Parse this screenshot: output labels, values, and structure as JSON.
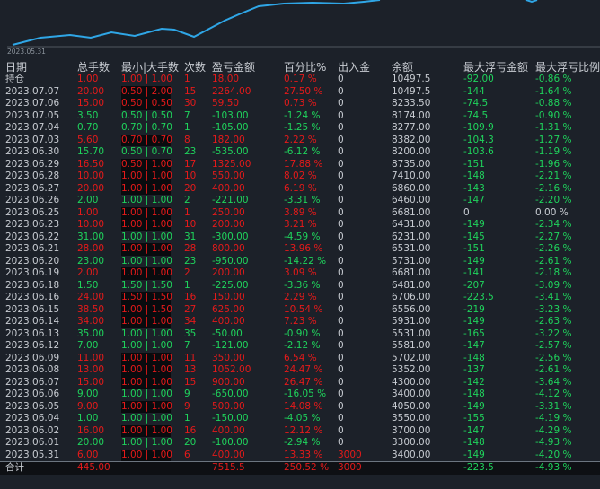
{
  "chart": {
    "date_label": "2023.05.31",
    "line_color": "#2fa6e6"
  },
  "headers": [
    "日期",
    "总手数",
    "最小|大手数",
    "次数",
    "盈亏金额",
    "百分比%",
    "出入金",
    "余额",
    "最大浮亏金额",
    "最大浮亏比例"
  ],
  "holding": {
    "label": "持仓",
    "lots": "1.00",
    "minmax": "1.00 | 1.00",
    "count": "1",
    "pnl": "18.00",
    "pct": "0.17 %",
    "flow": "0",
    "balance": "10497.5",
    "max_loss": "-92.00",
    "max_loss_pct": "-0.86 %"
  },
  "rows": [
    {
      "date": "2023.07.07",
      "lots": "20.00",
      "minmax": "0.50 | 2.00",
      "count": "15",
      "pnl": "2264.00",
      "pct": "27.50 %",
      "flow": "0",
      "balance": "10497.5",
      "max_loss": "-144",
      "max_loss_pct": "-1.64 %"
    },
    {
      "date": "2023.07.06",
      "lots": "15.00",
      "minmax": "0.50 | 0.50",
      "count": "30",
      "pnl": "59.50",
      "pct": "0.73 %",
      "flow": "0",
      "balance": "8233.50",
      "max_loss": "-74.5",
      "max_loss_pct": "-0.88 %"
    },
    {
      "date": "2023.07.05",
      "lots": "3.50",
      "minmax": "0.50 | 0.50",
      "count": "7",
      "pnl": "-103.00",
      "pct": "-1.24 %",
      "flow": "0",
      "balance": "8174.00",
      "max_loss": "-74.5",
      "max_loss_pct": "-0.90 %"
    },
    {
      "date": "2023.07.04",
      "lots": "0.70",
      "minmax": "0.70 | 0.70",
      "count": "1",
      "pnl": "-105.00",
      "pct": "-1.25 %",
      "flow": "0",
      "balance": "8277.00",
      "max_loss": "-109.9",
      "max_loss_pct": "-1.31 %"
    },
    {
      "date": "2023.07.03",
      "lots": "5.60",
      "minmax": "0.70 | 0.70",
      "count": "8",
      "pnl": "182.00",
      "pct": "2.22 %",
      "flow": "0",
      "balance": "8382.00",
      "max_loss": "-104.3",
      "max_loss_pct": "-1.27 %"
    },
    {
      "date": "2023.06.30",
      "lots": "15.70",
      "minmax": "0.50 | 0.70",
      "count": "23",
      "pnl": "-535.00",
      "pct": "-6.12 %",
      "flow": "0",
      "balance": "8200.00",
      "max_loss": "-103.6",
      "max_loss_pct": "-1.19 %"
    },
    {
      "date": "2023.06.29",
      "lots": "16.50",
      "minmax": "0.50 | 1.00",
      "count": "17",
      "pnl": "1325.00",
      "pct": "17.88 %",
      "flow": "0",
      "balance": "8735.00",
      "max_loss": "-151",
      "max_loss_pct": "-1.96 %"
    },
    {
      "date": "2023.06.28",
      "lots": "10.00",
      "minmax": "1.00 | 1.00",
      "count": "10",
      "pnl": "550.00",
      "pct": "8.02 %",
      "flow": "0",
      "balance": "7410.00",
      "max_loss": "-148",
      "max_loss_pct": "-2.21 %"
    },
    {
      "date": "2023.06.27",
      "lots": "20.00",
      "minmax": "1.00 | 1.00",
      "count": "20",
      "pnl": "400.00",
      "pct": "6.19 %",
      "flow": "0",
      "balance": "6860.00",
      "max_loss": "-143",
      "max_loss_pct": "-2.16 %"
    },
    {
      "date": "2023.06.26",
      "lots": "2.00",
      "minmax": "1.00 | 1.00",
      "count": "2",
      "pnl": "-221.00",
      "pct": "-3.31 %",
      "flow": "0",
      "balance": "6460.00",
      "max_loss": "-147",
      "max_loss_pct": "-2.20 %"
    },
    {
      "date": "2023.06.25",
      "lots": "1.00",
      "minmax": "1.00 | 1.00",
      "count": "1",
      "pnl": "250.00",
      "pct": "3.89 %",
      "flow": "0",
      "balance": "6681.00",
      "max_loss": "0",
      "max_loss_pct": "0.00 %"
    },
    {
      "date": "2023.06.23",
      "lots": "10.00",
      "minmax": "1.00 | 1.00",
      "count": "10",
      "pnl": "200.00",
      "pct": "3.21 %",
      "flow": "0",
      "balance": "6431.00",
      "max_loss": "-149",
      "max_loss_pct": "-2.34 %"
    },
    {
      "date": "2023.06.22",
      "lots": "31.00",
      "minmax": "1.00 | 1.00",
      "count": "31",
      "pnl": "-300.00",
      "pct": "-4.59 %",
      "flow": "0",
      "balance": "6231.00",
      "max_loss": "-145",
      "max_loss_pct": "-2.27 %"
    },
    {
      "date": "2023.06.21",
      "lots": "28.00",
      "minmax": "1.00 | 1.00",
      "count": "28",
      "pnl": "800.00",
      "pct": "13.96 %",
      "flow": "0",
      "balance": "6531.00",
      "max_loss": "-151",
      "max_loss_pct": "-2.26 %"
    },
    {
      "date": "2023.06.20",
      "lots": "23.00",
      "minmax": "1.00 | 1.00",
      "count": "23",
      "pnl": "-950.00",
      "pct": "-14.22 %",
      "flow": "0",
      "balance": "5731.00",
      "max_loss": "-149",
      "max_loss_pct": "-2.61 %"
    },
    {
      "date": "2023.06.19",
      "lots": "2.00",
      "minmax": "1.00 | 1.00",
      "count": "2",
      "pnl": "200.00",
      "pct": "3.09 %",
      "flow": "0",
      "balance": "6681.00",
      "max_loss": "-141",
      "max_loss_pct": "-2.18 %"
    },
    {
      "date": "2023.06.18",
      "lots": "1.50",
      "minmax": "1.50 | 1.50",
      "count": "1",
      "pnl": "-225.00",
      "pct": "-3.36 %",
      "flow": "0",
      "balance": "6481.00",
      "max_loss": "-207",
      "max_loss_pct": "-3.09 %"
    },
    {
      "date": "2023.06.16",
      "lots": "24.00",
      "minmax": "1.50 | 1.50",
      "count": "16",
      "pnl": "150.00",
      "pct": "2.29 %",
      "flow": "0",
      "balance": "6706.00",
      "max_loss": "-223.5",
      "max_loss_pct": "-3.41 %"
    },
    {
      "date": "2023.06.15",
      "lots": "38.50",
      "minmax": "1.00 | 1.50",
      "count": "27",
      "pnl": "625.00",
      "pct": "10.54 %",
      "flow": "0",
      "balance": "6556.00",
      "max_loss": "-219",
      "max_loss_pct": "-3.23 %"
    },
    {
      "date": "2023.06.14",
      "lots": "34.00",
      "minmax": "1.00 | 1.00",
      "count": "34",
      "pnl": "400.00",
      "pct": "7.23 %",
      "flow": "0",
      "balance": "5931.00",
      "max_loss": "-149",
      "max_loss_pct": "-2.63 %"
    },
    {
      "date": "2023.06.13",
      "lots": "35.00",
      "minmax": "1.00 | 1.00",
      "count": "35",
      "pnl": "-50.00",
      "pct": "-0.90 %",
      "flow": "0",
      "balance": "5531.00",
      "max_loss": "-165",
      "max_loss_pct": "-3.22 %"
    },
    {
      "date": "2023.06.12",
      "lots": "7.00",
      "minmax": "1.00 | 1.00",
      "count": "7",
      "pnl": "-121.00",
      "pct": "-2.12 %",
      "flow": "0",
      "balance": "5581.00",
      "max_loss": "-147",
      "max_loss_pct": "-2.57 %"
    },
    {
      "date": "2023.06.09",
      "lots": "11.00",
      "minmax": "1.00 | 1.00",
      "count": "11",
      "pnl": "350.00",
      "pct": "6.54 %",
      "flow": "0",
      "balance": "5702.00",
      "max_loss": "-148",
      "max_loss_pct": "-2.56 %"
    },
    {
      "date": "2023.06.08",
      "lots": "13.00",
      "minmax": "1.00 | 1.00",
      "count": "13",
      "pnl": "1052.00",
      "pct": "24.47 %",
      "flow": "0",
      "balance": "5352.00",
      "max_loss": "-137",
      "max_loss_pct": "-2.61 %"
    },
    {
      "date": "2023.06.07",
      "lots": "15.00",
      "minmax": "1.00 | 1.00",
      "count": "15",
      "pnl": "900.00",
      "pct": "26.47 %",
      "flow": "0",
      "balance": "4300.00",
      "max_loss": "-142",
      "max_loss_pct": "-3.64 %"
    },
    {
      "date": "2023.06.06",
      "lots": "9.00",
      "minmax": "1.00 | 1.00",
      "count": "9",
      "pnl": "-650.00",
      "pct": "-16.05 %",
      "flow": "0",
      "balance": "3400.00",
      "max_loss": "-148",
      "max_loss_pct": "-4.12 %"
    },
    {
      "date": "2023.06.05",
      "lots": "9.00",
      "minmax": "1.00 | 1.00",
      "count": "9",
      "pnl": "500.00",
      "pct": "14.08 %",
      "flow": "0",
      "balance": "4050.00",
      "max_loss": "-149",
      "max_loss_pct": "-3.31 %"
    },
    {
      "date": "2023.06.04",
      "lots": "1.00",
      "minmax": "1.00 | 1.00",
      "count": "1",
      "pnl": "-150.00",
      "pct": "-4.05 %",
      "flow": "0",
      "balance": "3550.00",
      "max_loss": "-155",
      "max_loss_pct": "-4.19 %"
    },
    {
      "date": "2023.06.02",
      "lots": "16.00",
      "minmax": "1.00 | 1.00",
      "count": "16",
      "pnl": "400.00",
      "pct": "12.12 %",
      "flow": "0",
      "balance": "3700.00",
      "max_loss": "-147",
      "max_loss_pct": "-4.29 %"
    },
    {
      "date": "2023.06.01",
      "lots": "20.00",
      "minmax": "1.00 | 1.00",
      "count": "20",
      "pnl": "-100.00",
      "pct": "-2.94 %",
      "flow": "0",
      "balance": "3300.00",
      "max_loss": "-148",
      "max_loss_pct": "-4.93 %"
    },
    {
      "date": "2023.05.31",
      "lots": "6.00",
      "minmax": "1.00 | 1.00",
      "count": "6",
      "pnl": "400.00",
      "pct": "13.33 %",
      "flow": "3000",
      "balance": "3400.00",
      "max_loss": "-149",
      "max_loss_pct": "-4.20 %"
    }
  ],
  "total": {
    "label": "合计",
    "lots": "445.00",
    "pnl": "7515.5",
    "pct": "250.52 %",
    "flow": "3000",
    "max_loss": "-223.5",
    "max_loss_pct": "-4.93 %"
  },
  "colors": {
    "background": "#1c2129",
    "profit": "#e51a1a",
    "loss": "#1fd35c",
    "text": "#c8ccd2"
  }
}
